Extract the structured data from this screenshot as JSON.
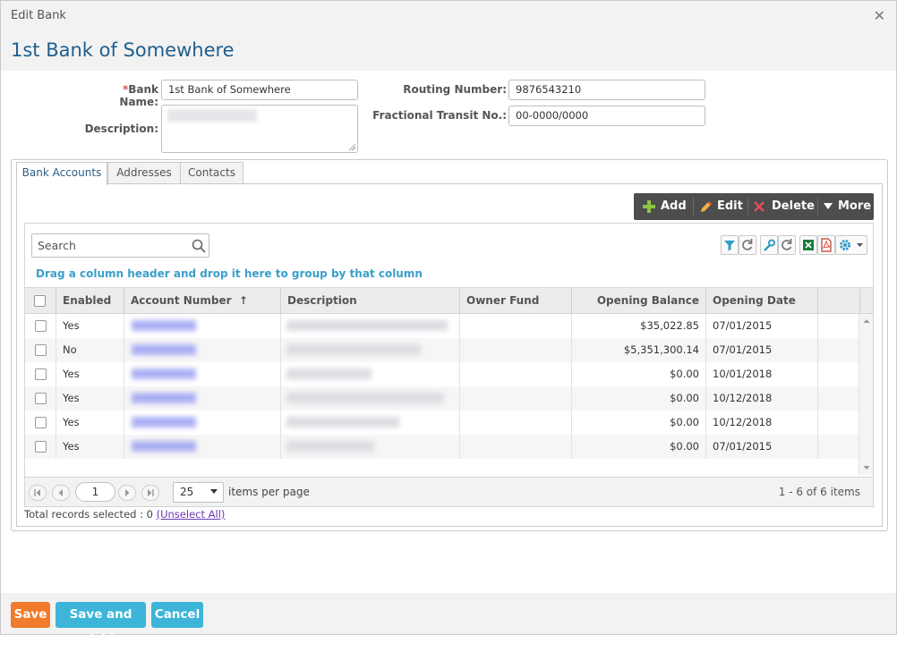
{
  "dialog": {
    "title": "Edit Bank",
    "close_glyph": "✕"
  },
  "header": {
    "bank_title": "1st Bank of Somewhere"
  },
  "form": {
    "bank_name_required_mark": "*",
    "bank_name_label": "Bank Name:",
    "bank_name_value": "1st Bank of Somewhere",
    "description_label": "Description:",
    "routing_number_label": "Routing Number:",
    "routing_number_value": "9876543210",
    "fractional_label": "Fractional Transit No.:",
    "fractional_value": "00-0000/0000"
  },
  "tabs": [
    {
      "label": "Bank Accounts",
      "active": true
    },
    {
      "label": "Addresses",
      "active": false
    },
    {
      "label": "Contacts",
      "active": false
    }
  ],
  "toolbar": {
    "add": "Add",
    "edit": "Edit",
    "delete": "Delete",
    "more": "More"
  },
  "grid": {
    "search_placeholder": "Search",
    "group_hint": "Drag a column header and drop it here to group by that column",
    "columns": [
      "Enabled",
      "Account Number",
      "Description",
      "Owner Fund",
      "Opening Balance",
      "Opening Date"
    ],
    "sort_glyph": "↑",
    "rows": [
      {
        "enabled": "Yes",
        "opening_balance": "$35,022.85",
        "opening_date": "07/01/2015"
      },
      {
        "enabled": "No",
        "opening_balance": "$5,351,300.14",
        "opening_date": "07/01/2015"
      },
      {
        "enabled": "Yes",
        "opening_balance": "$0.00",
        "opening_date": "10/01/2018"
      },
      {
        "enabled": "Yes",
        "opening_balance": "$0.00",
        "opening_date": "10/12/2018"
      },
      {
        "enabled": "Yes",
        "opening_balance": "$0.00",
        "opening_date": "10/12/2018"
      },
      {
        "enabled": "Yes",
        "opening_balance": "$0.00",
        "opening_date": "07/01/2015"
      }
    ]
  },
  "pager": {
    "page": "1",
    "page_size": "25",
    "items_per_page": "items per page",
    "info": "1 - 6 of 6 items"
  },
  "selection": {
    "text": "Total records selected : 0",
    "unselect": "(Unselect All)"
  },
  "footer": {
    "save": "Save",
    "save_and_add": "Save and Add",
    "cancel": "Cancel"
  },
  "colors": {
    "accent_blue": "#1e5f8f",
    "save_orange": "#f07b2a",
    "button_teal": "#3db5d8",
    "toolbar_dark": "#4d4d4d"
  },
  "icons": [
    "close-icon",
    "search-icon",
    "plus-icon",
    "pencil-icon",
    "delete-x-icon",
    "caret-down-icon",
    "filter-icon",
    "refresh-icon",
    "wrench-icon",
    "excel-icon",
    "pdf-icon",
    "gear-icon"
  ]
}
